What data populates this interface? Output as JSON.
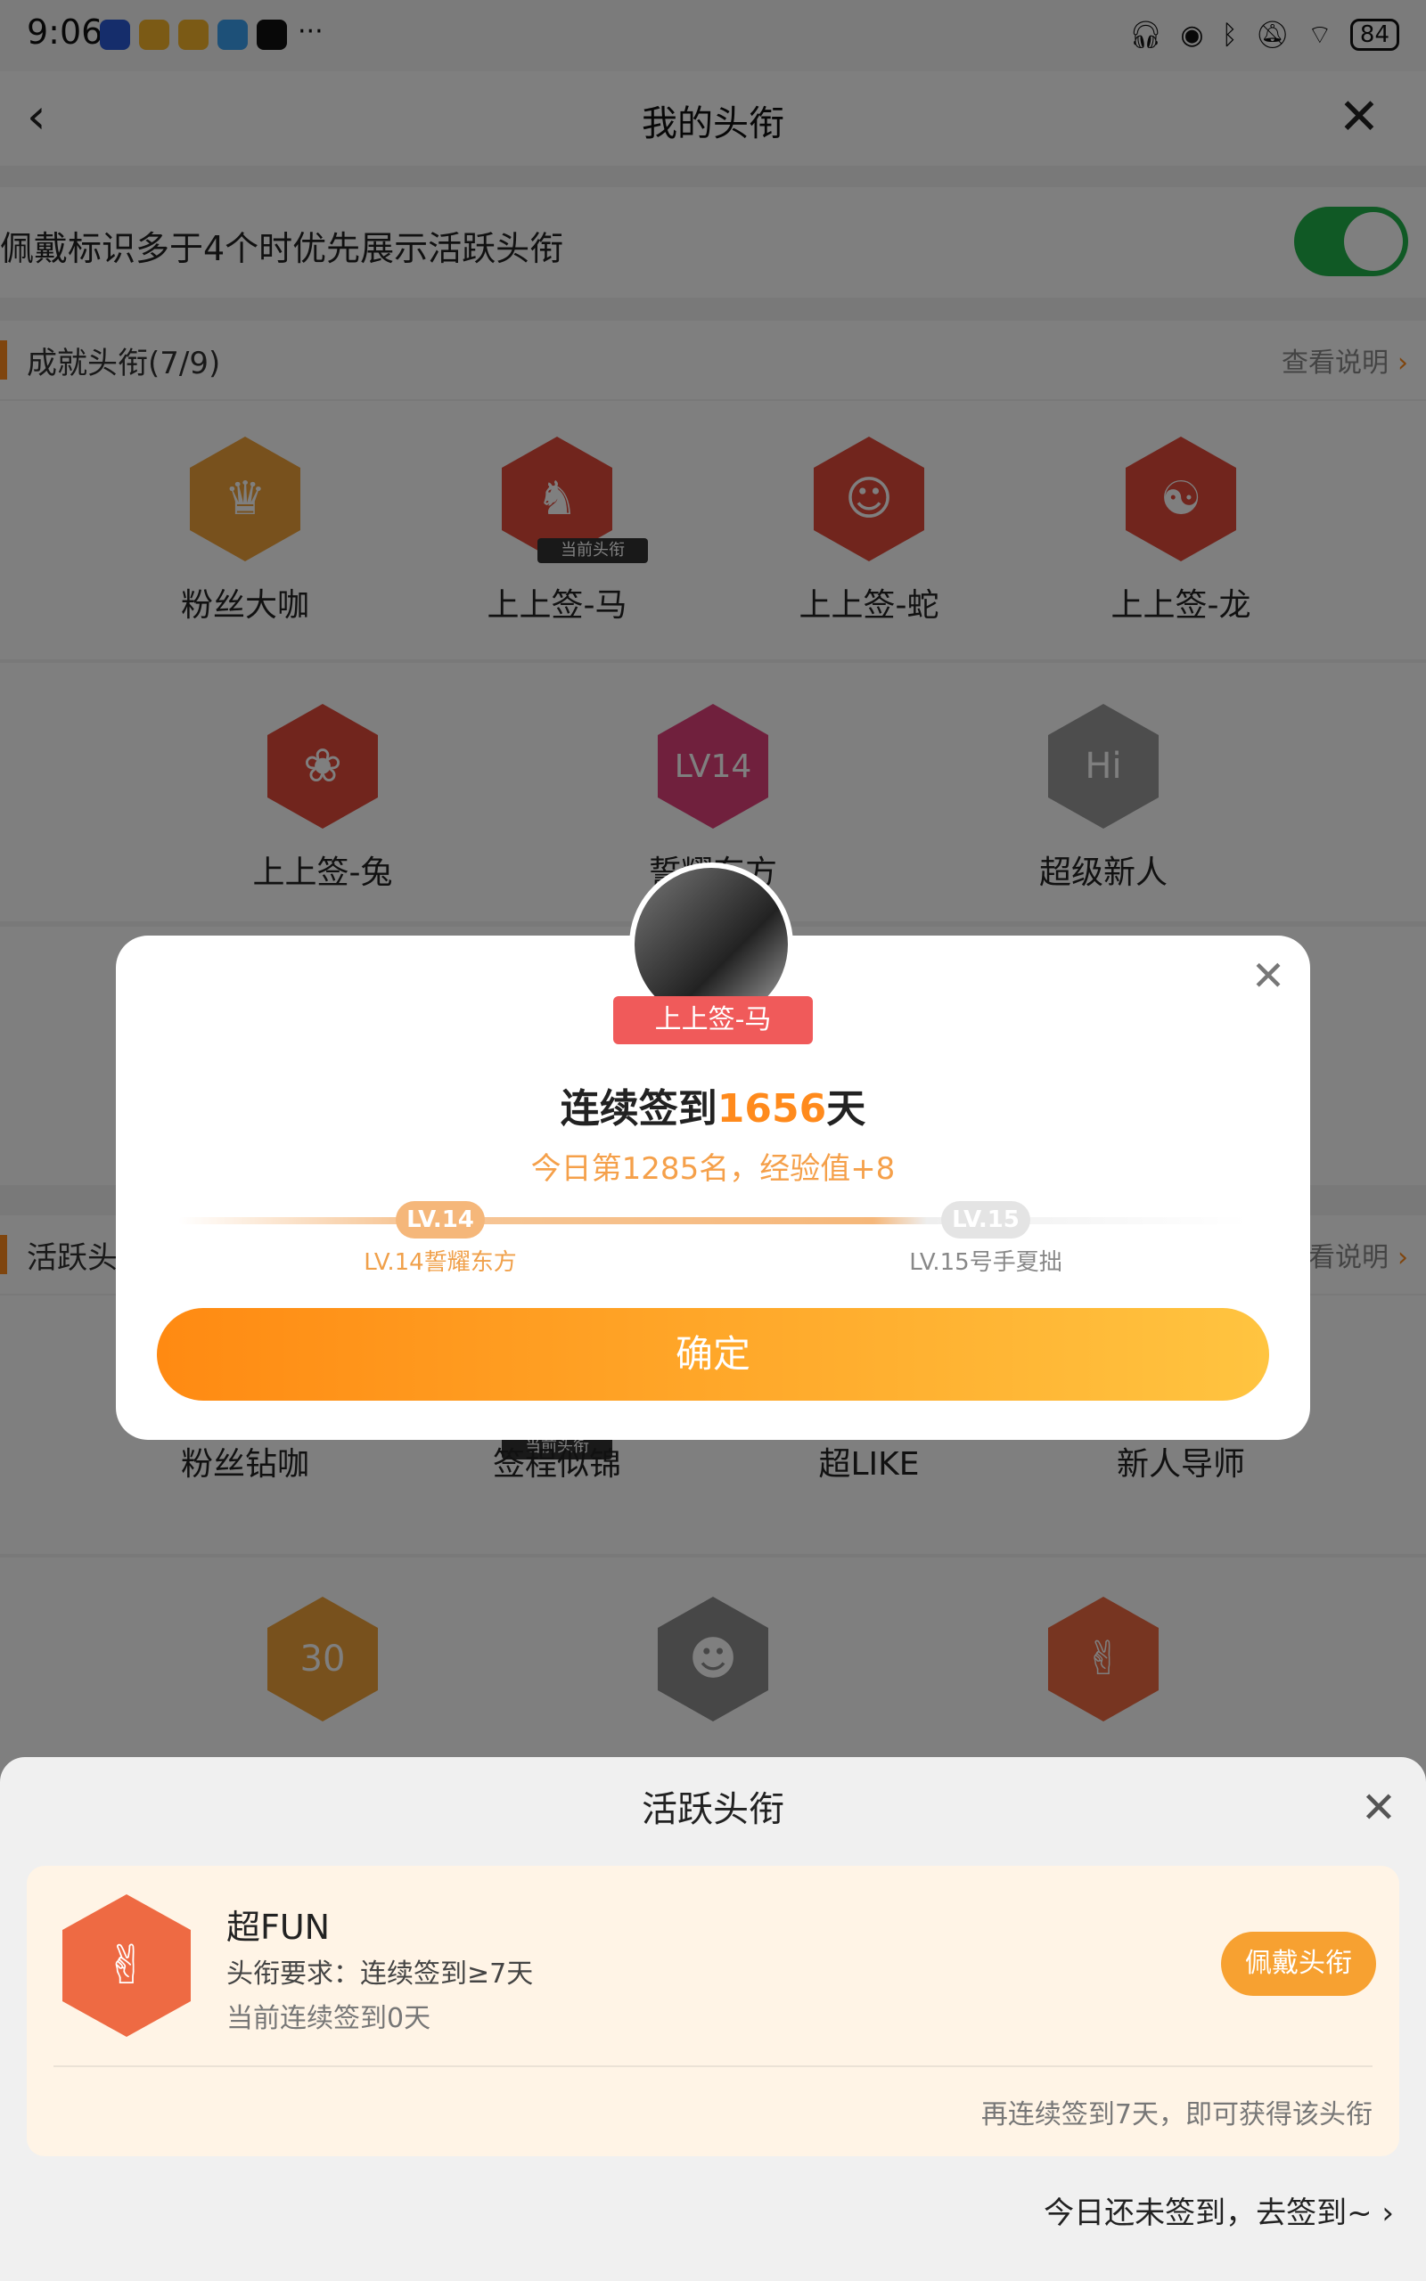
{
  "status_bar": {
    "time": "9:06",
    "more": "···",
    "battery": "84"
  },
  "nav": {
    "title": "我的头衔",
    "back_icon": "chevron-left-icon",
    "close_icon": "close-icon"
  },
  "toggle_row": {
    "text": "佩戴标识多于4个时优先展示活跃头衔",
    "enabled": true
  },
  "achievement": {
    "title": "成就头衔(7/9)",
    "link": "查看说明",
    "badges": [
      {
        "label": "粉丝大咖",
        "color": "#f1a23a"
      },
      {
        "label": "上上签-马",
        "color": "#e24a3b",
        "current": true,
        "current_tag": "当前头衔"
      },
      {
        "label": "上上签-蛇",
        "color": "#e24a3b"
      },
      {
        "label": "上上签-龙",
        "color": "#e24a3b"
      },
      {
        "label": "上上签-兔",
        "color": "#e24a3b"
      },
      {
        "label": "誓耀东方",
        "color": "#e0407a"
      },
      {
        "label": "超级新人",
        "color": "#9a9a9a"
      }
    ]
  },
  "active": {
    "title": "活跃头衔",
    "link": "查看说明",
    "badges": [
      {
        "label": "粉丝钻咖"
      },
      {
        "label": "签程似锦",
        "current_tag": "当前头衔"
      },
      {
        "label": "超LIKE"
      },
      {
        "label": "新人导师"
      }
    ]
  },
  "dialog": {
    "ribbon": "上上签-马",
    "title_prefix": "连续签到",
    "title_days": "1656",
    "title_suffix": "天",
    "subtitle": "今日第1285名，经验值+8",
    "lv_current": "LV.14",
    "lv_current_caption": "LV.14誓耀东方",
    "lv_next": "LV.15",
    "lv_next_caption": "LV.15号手夏拙",
    "progress_fraction": 0.65,
    "confirm": "确定"
  },
  "sheet": {
    "title": "活跃头衔",
    "card": {
      "name": "超FUN",
      "requirement": "头衔要求：连续签到≥7天",
      "current": "当前连续签到0天",
      "button": "佩戴头衔",
      "tip": "再连续签到7天，即可获得该头衔"
    },
    "sign_link": "今日还未签到，去签到~",
    "sign_chevron": "›"
  },
  "colors": {
    "accent": "#ff8a1c",
    "toggle_on": "#21b34a",
    "badge_red": "#e24a3b"
  }
}
